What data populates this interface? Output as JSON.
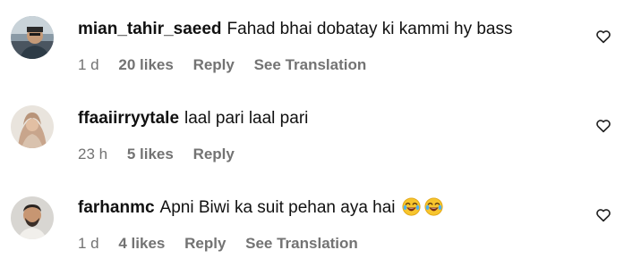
{
  "comments": [
    {
      "username": "mian_tahir_saeed",
      "text": "Fahad bhai dobatay ki kammi hy bass",
      "time": "1 d",
      "likes": "20 likes",
      "reply": "Reply",
      "translation": "See Translation"
    },
    {
      "username": "ffaaiirryytale",
      "text": "laal pari laal pari",
      "time": "23 h",
      "likes": "5 likes",
      "reply": "Reply"
    },
    {
      "username": "farhanmc",
      "text": "Apni Biwi ka suit pehan aya hai",
      "emoji": [
        "😂",
        "😂"
      ],
      "time": "1 d",
      "likes": "4 likes",
      "reply": "Reply",
      "translation": "See Translation"
    }
  ],
  "icons": {
    "like": "heart-outline-icon"
  },
  "colors": {
    "text": "#111111",
    "meta": "#737373",
    "background": "#ffffff"
  }
}
